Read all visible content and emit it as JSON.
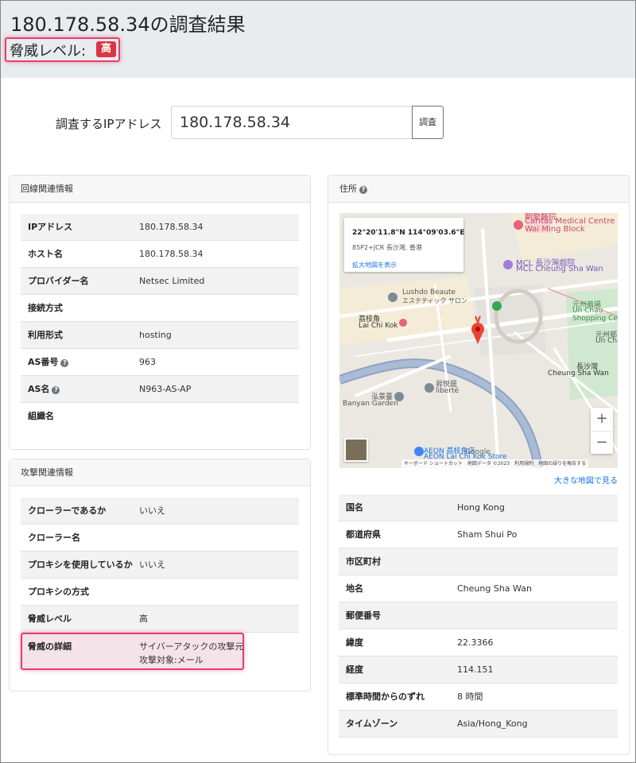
{
  "header": {
    "title": "180.178.58.34の調査結果",
    "threat_label": "脅威レベル:",
    "threat_badge": "高"
  },
  "search": {
    "label": "調査するIPアドレス",
    "value": "180.178.58.34",
    "button": "調査"
  },
  "network_card": {
    "title": "回線関連情報",
    "rows": [
      {
        "key": "IPアドレス",
        "value": "180.178.58.34",
        "help": false
      },
      {
        "key": "ホスト名",
        "value": "180.178.58.34",
        "help": false
      },
      {
        "key": "プロバイダー名",
        "value": "Netsec Limited",
        "help": false
      },
      {
        "key": "接続方式",
        "value": "",
        "help": false
      },
      {
        "key": "利用形式",
        "value": "hosting",
        "help": false
      },
      {
        "key": "AS番号",
        "value": "963",
        "help": true
      },
      {
        "key": "AS名",
        "value": "N963-AS-AP",
        "help": true
      },
      {
        "key": "組織名",
        "value": "",
        "help": false
      }
    ]
  },
  "attack_card": {
    "title": "攻撃関連情報",
    "rows": [
      {
        "key": "クローラーであるか",
        "value": "いいえ"
      },
      {
        "key": "クローラー名",
        "value": ""
      },
      {
        "key": "プロキシを使用しているか",
        "value": "いいえ"
      },
      {
        "key": "プロキシの方式",
        "value": ""
      },
      {
        "key": "脅威レベル",
        "value": "高"
      }
    ],
    "detail": {
      "key": "脅威の詳細",
      "line1": "サイバーアタックの攻撃元",
      "line2": "攻撃対象:メール"
    }
  },
  "address_card": {
    "title": "住所",
    "map": {
      "coord": "22°20'11.8\"N 114°09'03.6\"E",
      "plus_code": "85P2+JCR 長沙灣, 香港",
      "larger_link": "拡大地図を表示",
      "labels": {
        "caritas1": "明愛醫院",
        "caritas2": "Caritas Medical Centre",
        "caritas3": "Wai Ming Block",
        "mcl1": "MCL 長沙灣戲院",
        "mcl2": "MCL Cheung Sha Wan",
        "lushdo1": "Lushdo Beaute",
        "lushdo2": "エステティック サロン",
        "laichikok1": "荔枝角",
        "laichikok2": "Lai Chi Kok",
        "unchau1": "元州商場",
        "unchau2": "Un Chau",
        "unchau3": "Shopping Centre",
        "unchau_est1": "元州邨",
        "unchau_est2": "Un Chau Estate",
        "csw1": "長沙灣",
        "csw2": "Cheung Sha Wan",
        "liberte1": "昇悦居",
        "liberte2": "liberté",
        "banyan1": "泓景臺",
        "banyan2": "Banyan Garden",
        "aeon1": "AEON 荔枝角店",
        "aeon2": "AEON Lai Chi Kok Store",
        "google": "Google"
      },
      "attribution": "キーボード ショートカット　地図データ ©2023　利用規約　地図の誤りを報告する",
      "zoom_in": "+",
      "zoom_out": "−"
    },
    "bigger_map_link": "大きな地図で見る",
    "rows": [
      {
        "key": "国名",
        "value": "Hong Kong"
      },
      {
        "key": "都道府県",
        "value": "Sham Shui Po"
      },
      {
        "key": "市区町村",
        "value": ""
      },
      {
        "key": "地名",
        "value": "Cheung Sha Wan"
      },
      {
        "key": "郵便番号",
        "value": ""
      },
      {
        "key": "緯度",
        "value": "22.3366"
      },
      {
        "key": "経度",
        "value": "114.151"
      },
      {
        "key": "標準時間からのずれ",
        "value": "8 時間"
      },
      {
        "key": "タイムゾーン",
        "value": "Asia/Hong_Kong"
      }
    ]
  },
  "colors": {
    "danger": "#dc3545",
    "highlight_border": "#e83e6c",
    "link": "#1a73e8"
  }
}
